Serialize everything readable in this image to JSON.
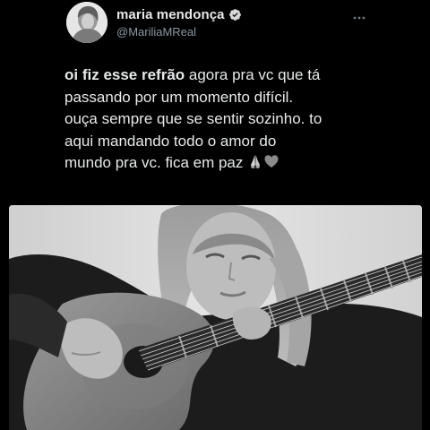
{
  "tweet": {
    "display_name": "maria mendonça",
    "handle": "@MariliaMReal",
    "verified_icon": "verified-badge-icon",
    "more_icon": "more-options-icon",
    "text": {
      "bold_lead": "oi fiz esse refrão",
      "line1_rest": " agora pra vc que tá",
      "line2": "passando por um momento difícil.",
      "line3": "ouça sempre que se sentir sozinho. to",
      "line4": "aqui mandando todo o amor do",
      "line5": "mundo pra vc. fica em paz",
      "emojis": [
        "folded-hands-emoji",
        "heart-emoji"
      ]
    },
    "media": {
      "type": "photo",
      "subject": "person-playing-guitar"
    }
  },
  "colors": {
    "background": "#000000",
    "text": "#e7e9ea",
    "secondary_text": "#8b98a5",
    "verified": "#bfbfbf"
  }
}
